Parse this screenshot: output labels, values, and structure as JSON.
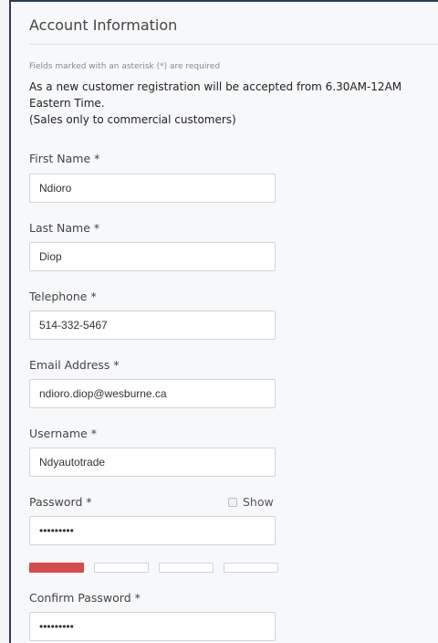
{
  "form": {
    "section_title": "Account Information",
    "required_note": "Fields marked with an asterisk (*) are required",
    "notice_lines": [
      "As a new customer registration will be accepted from 6.30AM-12AM",
      "Eastern Time.",
      "(Sales only to commercial customers)"
    ],
    "fields": {
      "first_name": {
        "label": "First Name *",
        "value": "Ndioro"
      },
      "last_name": {
        "label": "Last Name *",
        "value": "Diop"
      },
      "telephone": {
        "label": "Telephone *",
        "value": "514-332-5467"
      },
      "email": {
        "label": "Email Address *",
        "value": "ndioro.diop@wesburne.ca"
      },
      "username": {
        "label": "Username *",
        "value": "Ndyautotrade"
      },
      "password": {
        "label": "Password *",
        "value": "•••••••••"
      },
      "confirm_password": {
        "label": "Confirm Password *",
        "value": "•••••••••"
      }
    },
    "show_password_label": "Show",
    "password_strength": {
      "level": 1,
      "max": 4
    },
    "colors": {
      "strength_fill": "#d64b4b",
      "frame_border": "#2e3c54"
    }
  }
}
